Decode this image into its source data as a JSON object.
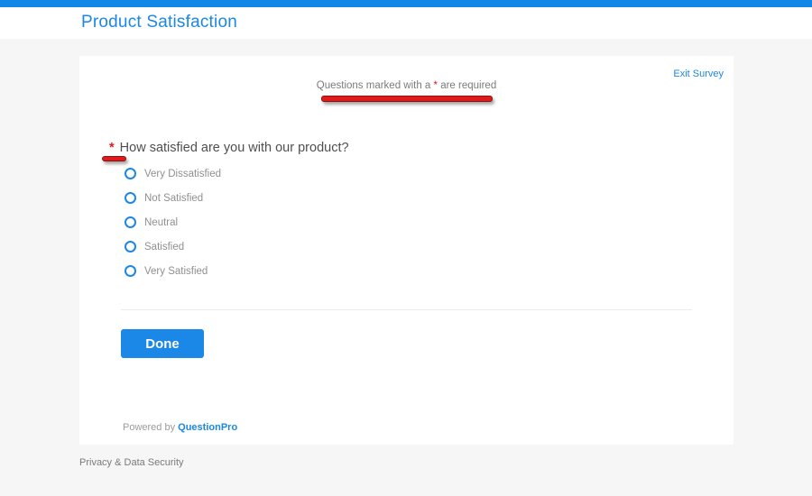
{
  "colors": {
    "accent": "#1b87e6",
    "topbar": "#1387e8",
    "annotation_red": "#e01a1a",
    "page_background": "#f6f6f6"
  },
  "header": {
    "title": "Product Satisfaction"
  },
  "card": {
    "exit_link_label": "Exit Survey",
    "required_note": {
      "prefix": "Questions marked with a ",
      "asterisk": "*",
      "suffix": " are required"
    },
    "question": {
      "asterisk": "*",
      "text": "How satisfied are you with our product?",
      "options": [
        {
          "label": "Very Dissatisfied",
          "selected": false
        },
        {
          "label": "Not Satisfied",
          "selected": false
        },
        {
          "label": "Neutral",
          "selected": false
        },
        {
          "label": "Satisfied",
          "selected": false
        },
        {
          "label": "Very Satisfied",
          "selected": false
        }
      ]
    },
    "done_button_label": "Done",
    "powered_by": {
      "prefix": "Powered by ",
      "brand": "QuestionPro"
    }
  },
  "footer": {
    "privacy_label": "Privacy & Data Security"
  }
}
